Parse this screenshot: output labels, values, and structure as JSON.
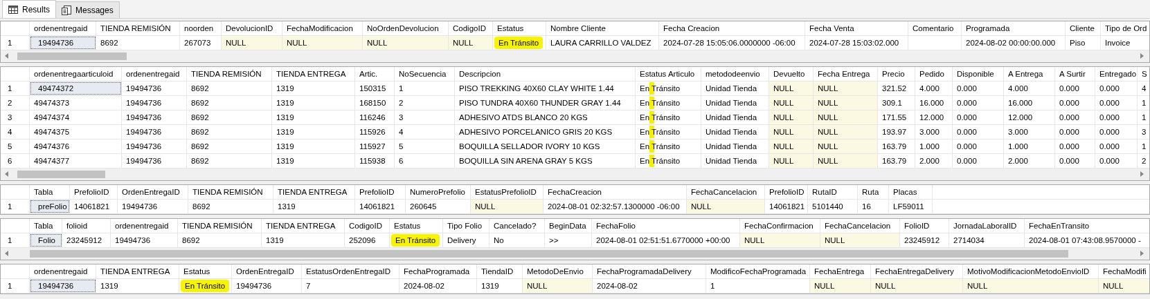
{
  "tabs": [
    {
      "label": "Results",
      "selected": true,
      "kind": "grid"
    },
    {
      "label": "Messages",
      "selected": false,
      "kind": "document"
    }
  ],
  "grids": [
    {
      "scrollbar": true,
      "columns": [
        "ordenentregaid",
        "TIENDA REMISIÓN",
        "noorden",
        "DevolucionID",
        "FechaModificacion",
        "NoOrdenDevolucion",
        "CodigoID",
        "Estatus",
        "Nombre Cliente",
        "Fecha Creacion",
        "Fecha Venta",
        "Comentario",
        "Programada",
        "Cliente",
        "Tipo de Ord"
      ],
      "rows": [
        {
          "number": "1",
          "cells": [
            {
              "text": "19494736",
              "selected": true
            },
            "8692",
            "267073",
            {
              "text": "NULL",
              "null": true
            },
            {
              "text": "NULL",
              "null": true
            },
            {
              "text": "NULL",
              "null": true
            },
            {
              "text": "NULL",
              "null": true
            },
            {
              "text": "En Tránsito",
              "highlighted": true
            },
            "LAURA CARRILLO VALDEZ",
            "2024-07-28 15:05:06.0000000 -06:00",
            "2024-07-28 15:03:02.000",
            null,
            "2024-08-02 00:00:00.000",
            "Piso",
            "Invoice"
          ]
        }
      ]
    },
    {
      "scrollbar": true,
      "columns": [
        "ordenentregaarticuloid",
        "ordenentregaid",
        "TIENDA REMISIÓN",
        "TIENDA ENTREGA",
        "Artic.",
        "NoSecuencia",
        "Descripcion",
        "Estatus Articulo",
        "metododeenvio",
        "Devuelto",
        "Fecha Entrega",
        "Precio",
        "Pedido",
        "Disponible",
        "A Entrega",
        "A Surtir",
        "Entregado",
        "S"
      ],
      "rows": [
        {
          "number": "1",
          "cells": [
            {
              "text": "49474372",
              "selected": true
            },
            "19494736",
            "8692",
            "1319",
            "150315",
            "1",
            "PISO TREKKING 40X60 CLAY WHITE 1.44",
            {
              "text": "En Tránsito",
              "stroke_mark": true
            },
            "Unidad Tienda",
            {
              "text": "NULL",
              "null": true
            },
            {
              "text": "NULL",
              "null": true
            },
            "321.52",
            "4.000",
            "0.000",
            "4.000",
            "0.000",
            "0.000",
            "4"
          ]
        },
        {
          "number": "2",
          "cells": [
            "49474373",
            "19494736",
            "8692",
            "1319",
            "168150",
            "2",
            "PISO TUNDRA 40X60 THUNDER GRAY 1.44",
            {
              "text": "En Tránsito",
              "stroke_mark": true
            },
            "Unidad Tienda",
            {
              "text": "NULL",
              "null": true
            },
            {
              "text": "NULL",
              "null": true
            },
            "309.1",
            "16.000",
            "0.000",
            "16.000",
            "0.000",
            "0.000",
            "1"
          ]
        },
        {
          "number": "3",
          "cells": [
            "49474374",
            "19494736",
            "8692",
            "1319",
            "116246",
            "3",
            "ADHESIVO ATDS BLANCO 20 KGS",
            {
              "text": "En Tránsito",
              "stroke_mark": true
            },
            "Unidad Tienda",
            {
              "text": "NULL",
              "null": true
            },
            {
              "text": "NULL",
              "null": true
            },
            "171.55",
            "12.000",
            "0.000",
            "12.000",
            "0.000",
            "0.000",
            "1"
          ]
        },
        {
          "number": "4",
          "cells": [
            "49474375",
            "19494736",
            "8692",
            "1319",
            "115926",
            "4",
            "ADHESIVO PORCELANICO GRIS 20 KGS",
            {
              "text": "En Tránsito",
              "stroke_mark": true
            },
            "Unidad Tienda",
            {
              "text": "NULL",
              "null": true
            },
            {
              "text": "NULL",
              "null": true
            },
            "193.97",
            "3.000",
            "0.000",
            "3.000",
            "0.000",
            "0.000",
            "3"
          ]
        },
        {
          "number": "5",
          "cells": [
            "49474376",
            "19494736",
            "8692",
            "1319",
            "115927",
            "5",
            "BOQUILLA SELLADOR IVORY 10 KGS",
            {
              "text": "En Tránsito",
              "stroke_mark": true
            },
            "Unidad Tienda",
            {
              "text": "NULL",
              "null": true
            },
            {
              "text": "NULL",
              "null": true
            },
            "163.79",
            "1.000",
            "0.000",
            "1.000",
            "0.000",
            "0.000",
            "1"
          ]
        },
        {
          "number": "6",
          "cells": [
            "49474377",
            "19494736",
            "8692",
            "1319",
            "115938",
            "6",
            "BOQUILLA SIN ARENA GRAY 5 KGS",
            {
              "text": "En Tránsito",
              "stroke_mark": true
            },
            "Unidad Tienda",
            {
              "text": "NULL",
              "null": true
            },
            {
              "text": "NULL",
              "null": true
            },
            "163.79",
            "2.000",
            "0.000",
            "2.000",
            "0.000",
            "0.000",
            "2"
          ]
        }
      ]
    },
    {
      "scrollbar": false,
      "columns": [
        "Tabla",
        "PrefolioID",
        "OrdenEntregaID",
        "TIENDA REMISIÓN",
        "TIENDA ENTREGA",
        "PrefolioID",
        "NumeroPrefolio",
        "EstatusPrefolioID",
        "FechaCreacion",
        "FechaCancelacion",
        "PrefolioID",
        "RutaID",
        "Ruta",
        "Placas"
      ],
      "rows": [
        {
          "number": "1",
          "cells": [
            {
              "text": "preFolio",
              "selected": true
            },
            "14061821",
            "19494736",
            "8692",
            "1319",
            "14061821",
            "260645",
            {
              "text": "NULL",
              "null": true
            },
            "2024-08-01 02:32:57.1300000 -06:00",
            {
              "text": "NULL",
              "null": true
            },
            "14061821",
            "5101440",
            "16",
            "LF59011"
          ]
        }
      ]
    },
    {
      "scrollbar": true,
      "columns": [
        "Tabla",
        "folioid",
        "ordenentregaid",
        "TIENDA REMISIÓN",
        "TIENDA ENTREGA",
        "CodigoID",
        "Estatus",
        "Tipo Folio",
        "Cancelado?",
        "BeginData",
        "FechaFolio",
        "FechaConfirmacion",
        "FechaCancelacion",
        "FolioID",
        "JornadaLaboralID",
        "FechaEnTransito"
      ],
      "rows": [
        {
          "number": "1",
          "cells": [
            {
              "text": "Folio",
              "selected": true
            },
            "23245912",
            "19494736",
            "8692",
            "1319",
            "252096",
            {
              "text": "En Tránsito",
              "highlighted": true
            },
            "Delivery",
            "No",
            ">>",
            "2024-08-01 02:51:51.6770000 +00:00",
            {
              "text": "NULL",
              "null": true
            },
            {
              "text": "NULL",
              "null": true
            },
            "23245912",
            "2714034",
            "2024-08-01 07:43:08.9570000 -"
          ]
        }
      ]
    },
    {
      "scrollbar": false,
      "columns": [
        "ordenentregaid",
        "TIENDA ENTREGA",
        "Estatus",
        "OrdenEntregaID",
        "EstatusOrdenEntregaID",
        "FechaProgramada",
        "TiendaID",
        "MetodoDeEnvio",
        "FechaProgramadaDelivery",
        "ModificoFechaProgramada",
        "FechaEntrega",
        "FechaEntregaDelivery",
        "MotivoModificacionMetodoEnvioID",
        "FechaModifi"
      ],
      "rows": [
        {
          "number": "1",
          "cells": [
            {
              "text": "19494736",
              "selected": true
            },
            "1319",
            {
              "text": "En Tránsito",
              "highlighted": true
            },
            "19494736",
            "7",
            "2024-08-02",
            "1319",
            {
              "text": "NULL",
              "null": true
            },
            "2024-08-02",
            "1",
            {
              "text": "NULL",
              "null": true
            },
            {
              "text": "NULL",
              "null": true
            },
            {
              "text": "NULL",
              "null": true
            },
            {
              "text": "NULL",
              "null": true
            }
          ]
        }
      ]
    }
  ]
}
